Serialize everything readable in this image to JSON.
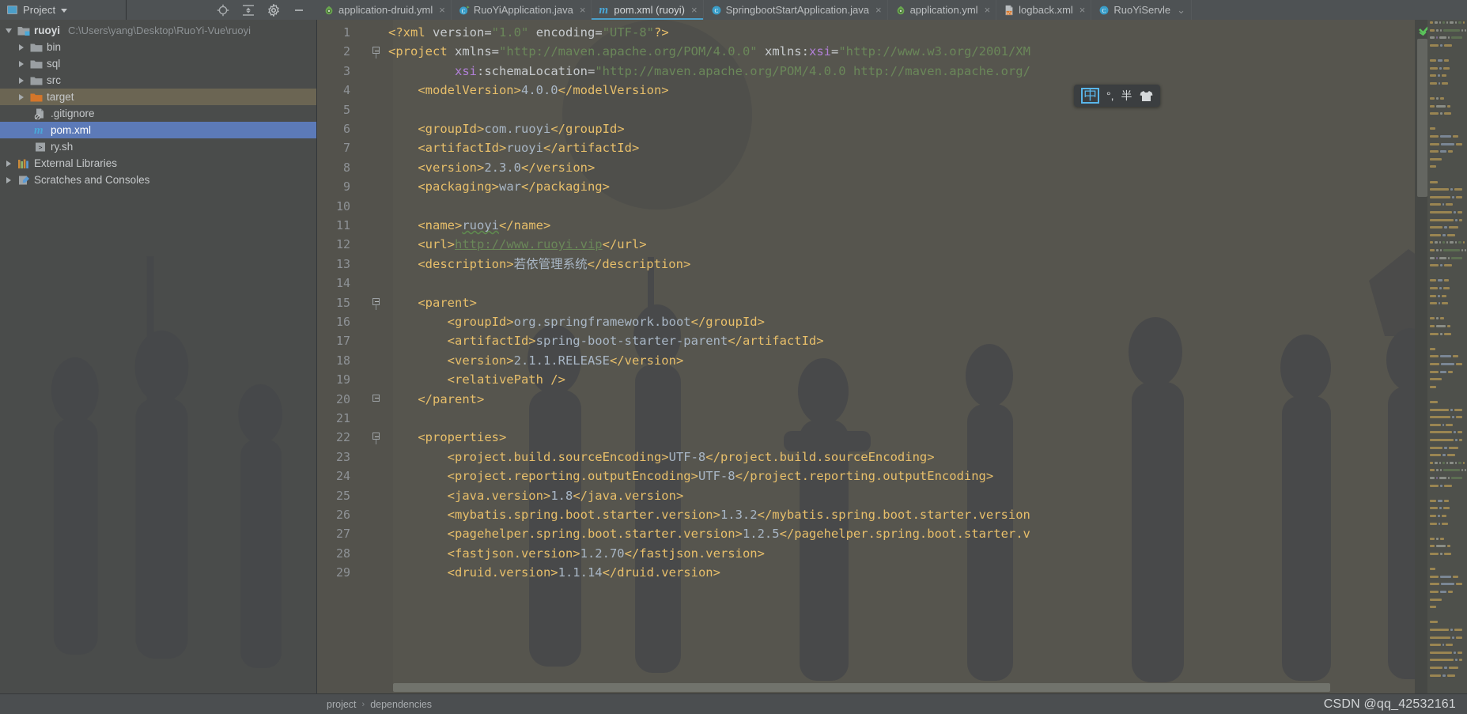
{
  "window": {
    "project_panel_title": "Project",
    "toolbar_icons": [
      "locate-icon",
      "collapse-all-icon",
      "settings-icon",
      "minimize-icon"
    ]
  },
  "project_tree": [
    {
      "label": "ruoyi",
      "path": "C:\\Users\\yang\\Desktop\\RuoYi-Vue\\ruoyi",
      "icon": "module-folder-icon",
      "expanded": true,
      "depth": 0,
      "state": "normal",
      "bold": true
    },
    {
      "label": "bin",
      "path": "",
      "icon": "folder-icon",
      "expanded": false,
      "depth": 1,
      "state": "normal",
      "bold": false
    },
    {
      "label": "sql",
      "path": "",
      "icon": "folder-icon",
      "expanded": false,
      "depth": 1,
      "state": "normal",
      "bold": false
    },
    {
      "label": "src",
      "path": "",
      "icon": "folder-icon",
      "expanded": false,
      "depth": 1,
      "state": "normal",
      "bold": false
    },
    {
      "label": "target",
      "path": "",
      "icon": "excluded-folder-icon",
      "expanded": false,
      "depth": 1,
      "state": "highlight",
      "bold": false
    },
    {
      "label": ".gitignore",
      "path": "",
      "icon": "gitignore-file-icon",
      "expanded": null,
      "depth": 2,
      "state": "normal",
      "bold": false
    },
    {
      "label": "pom.xml",
      "path": "",
      "icon": "maven-file-icon",
      "expanded": null,
      "depth": 2,
      "state": "selected",
      "bold": false
    },
    {
      "label": "ry.sh",
      "path": "",
      "icon": "shell-file-icon",
      "expanded": null,
      "depth": 2,
      "state": "normal",
      "bold": false
    },
    {
      "label": "External Libraries",
      "path": "",
      "icon": "libraries-icon",
      "expanded": false,
      "depth": 0,
      "state": "normal",
      "bold": false
    },
    {
      "label": "Scratches and Consoles",
      "path": "",
      "icon": "scratches-icon",
      "expanded": false,
      "depth": 0,
      "state": "normal",
      "bold": false
    }
  ],
  "tabs": [
    {
      "label": "application-druid.yml",
      "icon": "yaml-file-icon",
      "active": false,
      "closable": true
    },
    {
      "label": "RuoYiApplication.java",
      "icon": "spring-class-icon",
      "active": false,
      "closable": true
    },
    {
      "label": "pom.xml (ruoyi)",
      "icon": "maven-file-icon",
      "active": true,
      "closable": true
    },
    {
      "label": "SpringbootStartApplication.java",
      "icon": "java-class-icon",
      "active": false,
      "closable": true
    },
    {
      "label": "application.yml",
      "icon": "yaml-file-icon",
      "active": false,
      "closable": true
    },
    {
      "label": "logback.xml",
      "icon": "xml-file-icon",
      "active": false,
      "closable": true
    },
    {
      "label": "RuoYiServle",
      "icon": "java-class-icon",
      "active": false,
      "closable": false
    }
  ],
  "editor": {
    "filename": "pom.xml",
    "first_line": 1,
    "lines": [
      {
        "n": 1,
        "fold": "none",
        "tokens": [
          {
            "t": "<?xml ",
            "c": "tag"
          },
          {
            "t": "version",
            "c": "attr"
          },
          {
            "t": "=",
            "c": "plain"
          },
          {
            "t": "\"1.0\"",
            "c": "str"
          },
          {
            "t": " ",
            "c": "plain"
          },
          {
            "t": "encoding",
            "c": "attr"
          },
          {
            "t": "=",
            "c": "plain"
          },
          {
            "t": "\"UTF-8\"",
            "c": "str"
          },
          {
            "t": "?>",
            "c": "tag"
          }
        ]
      },
      {
        "n": 2,
        "fold": "open",
        "tokens": [
          {
            "t": "<project ",
            "c": "tag"
          },
          {
            "t": "xmlns",
            "c": "attr"
          },
          {
            "t": "=",
            "c": "plain"
          },
          {
            "t": "\"http://maven.apache.org/POM/4.0.0\"",
            "c": "str"
          },
          {
            "t": " ",
            "c": "plain"
          },
          {
            "t": "xmlns:",
            "c": "attr"
          },
          {
            "t": "xsi",
            "c": "ns"
          },
          {
            "t": "=",
            "c": "plain"
          },
          {
            "t": "\"http://www.w3.org/2001/XM",
            "c": "str"
          }
        ]
      },
      {
        "n": 3,
        "fold": "none",
        "tokens": [
          {
            "t": "         ",
            "c": "plain"
          },
          {
            "t": "xsi",
            "c": "ns"
          },
          {
            "t": ":schemaLocation",
            "c": "attr"
          },
          {
            "t": "=",
            "c": "plain"
          },
          {
            "t": "\"http://maven.apache.org/POM/4.0.0 http://maven.apache.org/",
            "c": "str"
          }
        ]
      },
      {
        "n": 4,
        "fold": "none",
        "tokens": [
          {
            "t": "    <modelVersion>",
            "c": "tag"
          },
          {
            "t": "4.0.0",
            "c": "txt"
          },
          {
            "t": "</modelVersion>",
            "c": "tag"
          }
        ]
      },
      {
        "n": 5,
        "fold": "none",
        "tokens": []
      },
      {
        "n": 6,
        "fold": "none",
        "tokens": [
          {
            "t": "    <groupId>",
            "c": "tag"
          },
          {
            "t": "com.ruoyi",
            "c": "txt"
          },
          {
            "t": "</groupId>",
            "c": "tag"
          }
        ]
      },
      {
        "n": 7,
        "fold": "none",
        "tokens": [
          {
            "t": "    <artifactId>",
            "c": "tag"
          },
          {
            "t": "ruoyi",
            "c": "txt"
          },
          {
            "t": "</artifactId>",
            "c": "tag"
          }
        ]
      },
      {
        "n": 8,
        "fold": "none",
        "tokens": [
          {
            "t": "    <version>",
            "c": "tag"
          },
          {
            "t": "2.3.0",
            "c": "txt"
          },
          {
            "t": "</version>",
            "c": "tag"
          }
        ]
      },
      {
        "n": 9,
        "fold": "none",
        "tokens": [
          {
            "t": "    <packaging>",
            "c": "tag"
          },
          {
            "t": "war",
            "c": "txt"
          },
          {
            "t": "</packaging>",
            "c": "tag"
          }
        ]
      },
      {
        "n": 10,
        "fold": "none",
        "tokens": []
      },
      {
        "n": 11,
        "fold": "none",
        "tokens": [
          {
            "t": "    <name>",
            "c": "tag"
          },
          {
            "t": "ruoyi",
            "c": "squiggle"
          },
          {
            "t": "</name>",
            "c": "tag"
          }
        ]
      },
      {
        "n": 12,
        "fold": "none",
        "tokens": [
          {
            "t": "    <url>",
            "c": "tag"
          },
          {
            "t": "http://www.ruoyi.vip",
            "c": "link"
          },
          {
            "t": "</url>",
            "c": "tag"
          }
        ]
      },
      {
        "n": 13,
        "fold": "none",
        "tokens": [
          {
            "t": "    <description>",
            "c": "tag"
          },
          {
            "t": "若依管理系统",
            "c": "cn"
          },
          {
            "t": "</description>",
            "c": "tag"
          }
        ]
      },
      {
        "n": 14,
        "fold": "none",
        "tokens": []
      },
      {
        "n": 15,
        "fold": "open",
        "tokens": [
          {
            "t": "    <parent>",
            "c": "tag"
          }
        ]
      },
      {
        "n": 16,
        "fold": "none",
        "tokens": [
          {
            "t": "        <groupId>",
            "c": "tag"
          },
          {
            "t": "org.springframework.boot",
            "c": "txt"
          },
          {
            "t": "</groupId>",
            "c": "tag"
          }
        ]
      },
      {
        "n": 17,
        "fold": "none",
        "tokens": [
          {
            "t": "        <artifactId>",
            "c": "tag"
          },
          {
            "t": "spring-boot-starter-parent",
            "c": "txt"
          },
          {
            "t": "</artifactId>",
            "c": "tag"
          }
        ]
      },
      {
        "n": 18,
        "fold": "none",
        "tokens": [
          {
            "t": "        <version>",
            "c": "tag"
          },
          {
            "t": "2.1.1.RELEASE",
            "c": "txt"
          },
          {
            "t": "</version>",
            "c": "tag"
          }
        ]
      },
      {
        "n": 19,
        "fold": "none",
        "tokens": [
          {
            "t": "        <relativePath />",
            "c": "tag"
          }
        ]
      },
      {
        "n": 20,
        "fold": "close",
        "tokens": [
          {
            "t": "    </parent>",
            "c": "tag"
          }
        ]
      },
      {
        "n": 21,
        "fold": "none",
        "tokens": []
      },
      {
        "n": 22,
        "fold": "open",
        "tokens": [
          {
            "t": "    <properties>",
            "c": "tag"
          }
        ]
      },
      {
        "n": 23,
        "fold": "none",
        "tokens": [
          {
            "t": "        <project.build.sourceEncoding>",
            "c": "tag"
          },
          {
            "t": "UTF-8",
            "c": "txt"
          },
          {
            "t": "</project.build.sourceEncoding>",
            "c": "tag"
          }
        ]
      },
      {
        "n": 24,
        "fold": "none",
        "tokens": [
          {
            "t": "        <project.reporting.outputEncoding>",
            "c": "tag"
          },
          {
            "t": "UTF-8",
            "c": "txt"
          },
          {
            "t": "</project.reporting.outputEncoding>",
            "c": "tag"
          }
        ]
      },
      {
        "n": 25,
        "fold": "none",
        "tokens": [
          {
            "t": "        <java.version>",
            "c": "tag"
          },
          {
            "t": "1.8",
            "c": "txt"
          },
          {
            "t": "</java.version>",
            "c": "tag"
          }
        ]
      },
      {
        "n": 26,
        "fold": "none",
        "tokens": [
          {
            "t": "        <mybatis.spring.boot.starter.version>",
            "c": "tag"
          },
          {
            "t": "1.3.2",
            "c": "txt"
          },
          {
            "t": "</mybatis.spring.boot.starter.version",
            "c": "tag"
          }
        ]
      },
      {
        "n": 27,
        "fold": "none",
        "tokens": [
          {
            "t": "        <pagehelper.spring.boot.starter.version>",
            "c": "tag"
          },
          {
            "t": "1.2.5",
            "c": "txt"
          },
          {
            "t": "</pagehelper.spring.boot.starter.v",
            "c": "tag"
          }
        ]
      },
      {
        "n": 28,
        "fold": "none",
        "tokens": [
          {
            "t": "        <fastjson.version>",
            "c": "tag"
          },
          {
            "t": "1.2.70",
            "c": "txt"
          },
          {
            "t": "</fastjson.version>",
            "c": "tag"
          }
        ]
      },
      {
        "n": 29,
        "fold": "none",
        "tokens": [
          {
            "t": "        <druid.version>",
            "c": "tag"
          },
          {
            "t": "1.1.14",
            "c": "txt"
          },
          {
            "t": "</druid.version>",
            "c": "tag"
          }
        ]
      }
    ],
    "inspection_status": "ok-check-icon"
  },
  "ime": {
    "mode": "中",
    "punctuation": "°,",
    "width_mode": "半",
    "extra": "shirt-icon"
  },
  "status_bar": {
    "breadcrumbs": [
      "project",
      "dependencies"
    ],
    "separator": "›",
    "watermark": "CSDN @qq_42532161"
  },
  "colors": {
    "accent": "#4b9ec9",
    "selection": "#5c7ab8",
    "tag": "#e8bf6a",
    "string": "#6a8759",
    "text_value": "#a9b7c6",
    "namespace": "#b180d7",
    "editor_bg": "#56554e",
    "tree_bg": "#4a4c4b",
    "chrome_bg": "#4e5254"
  }
}
